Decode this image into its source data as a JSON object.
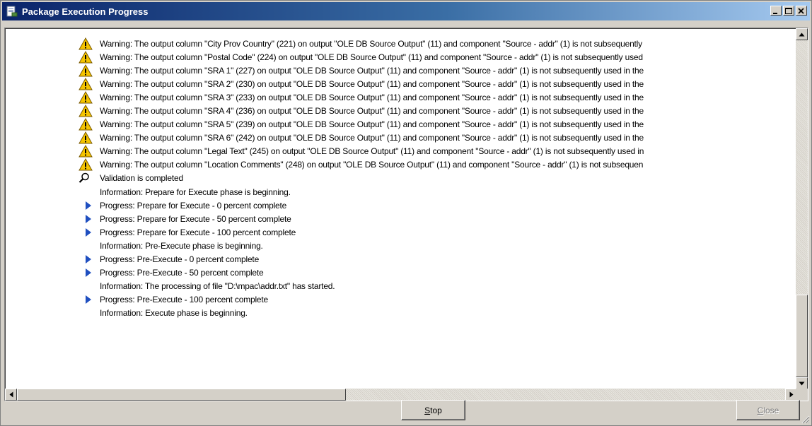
{
  "window": {
    "title": "Package Execution Progress"
  },
  "log": {
    "rows": [
      {
        "type": "warning",
        "text": "Warning: The output column \"City Prov Country\" (221) on output \"OLE DB Source Output\" (11) and component \"Source - addr\" (1) is not subsequently"
      },
      {
        "type": "warning",
        "text": "Warning: The output column \"Postal Code\" (224) on output \"OLE DB Source Output\" (11) and component \"Source - addr\" (1) is not subsequently used"
      },
      {
        "type": "warning",
        "text": "Warning: The output column \"SRA 1\" (227) on output \"OLE DB Source Output\" (11) and component \"Source - addr\" (1) is not subsequently used in the"
      },
      {
        "type": "warning",
        "text": "Warning: The output column \"SRA 2\" (230) on output \"OLE DB Source Output\" (11) and component \"Source - addr\" (1) is not subsequently used in the"
      },
      {
        "type": "warning",
        "text": "Warning: The output column \"SRA 3\" (233) on output \"OLE DB Source Output\" (11) and component \"Source - addr\" (1) is not subsequently used in the"
      },
      {
        "type": "warning",
        "text": "Warning: The output column \"SRA 4\" (236) on output \"OLE DB Source Output\" (11) and component \"Source - addr\" (1) is not subsequently used in the"
      },
      {
        "type": "warning",
        "text": "Warning: The output column \"SRA 5\" (239) on output \"OLE DB Source Output\" (11) and component \"Source - addr\" (1) is not subsequently used in the"
      },
      {
        "type": "warning",
        "text": "Warning: The output column \"SRA 6\" (242) on output \"OLE DB Source Output\" (11) and component \"Source - addr\" (1) is not subsequently used in the"
      },
      {
        "type": "warning",
        "text": "Warning: The output column \"Legal Text\" (245) on output \"OLE DB Source Output\" (11) and component \"Source - addr\" (1) is not subsequently used in"
      },
      {
        "type": "warning",
        "text": "Warning: The output column \"Location Comments\" (248) on output \"OLE DB Source Output\" (11) and component \"Source - addr\" (1) is not subsequen"
      },
      {
        "type": "validation",
        "text": "Validation is completed"
      },
      {
        "type": "info",
        "text": "Information: Prepare for Execute phase is beginning."
      },
      {
        "type": "progress",
        "text": "Progress: Prepare for Execute - 0 percent complete"
      },
      {
        "type": "progress",
        "text": "Progress: Prepare for Execute - 50 percent complete"
      },
      {
        "type": "progress",
        "text": "Progress: Prepare for Execute - 100 percent complete"
      },
      {
        "type": "info",
        "text": "Information: Pre-Execute phase is beginning."
      },
      {
        "type": "progress",
        "text": "Progress: Pre-Execute - 0 percent complete"
      },
      {
        "type": "progress",
        "text": "Progress: Pre-Execute - 50 percent complete"
      },
      {
        "type": "info",
        "text": "Information: The processing of file \"D:\\mpac\\addr.txt\" has started."
      },
      {
        "type": "progress",
        "text": "Progress: Pre-Execute - 100 percent complete"
      },
      {
        "type": "info",
        "text": "Information: Execute phase is beginning."
      }
    ]
  },
  "buttons": {
    "stop_mnemonic": "S",
    "stop_rest": "top",
    "close_mnemonic": "C",
    "close_rest": "lose"
  },
  "colors": {
    "warning": "#f5c400",
    "progress": "#1f4fc0",
    "title_start": "#0a246a",
    "title_end": "#a6caf0"
  }
}
